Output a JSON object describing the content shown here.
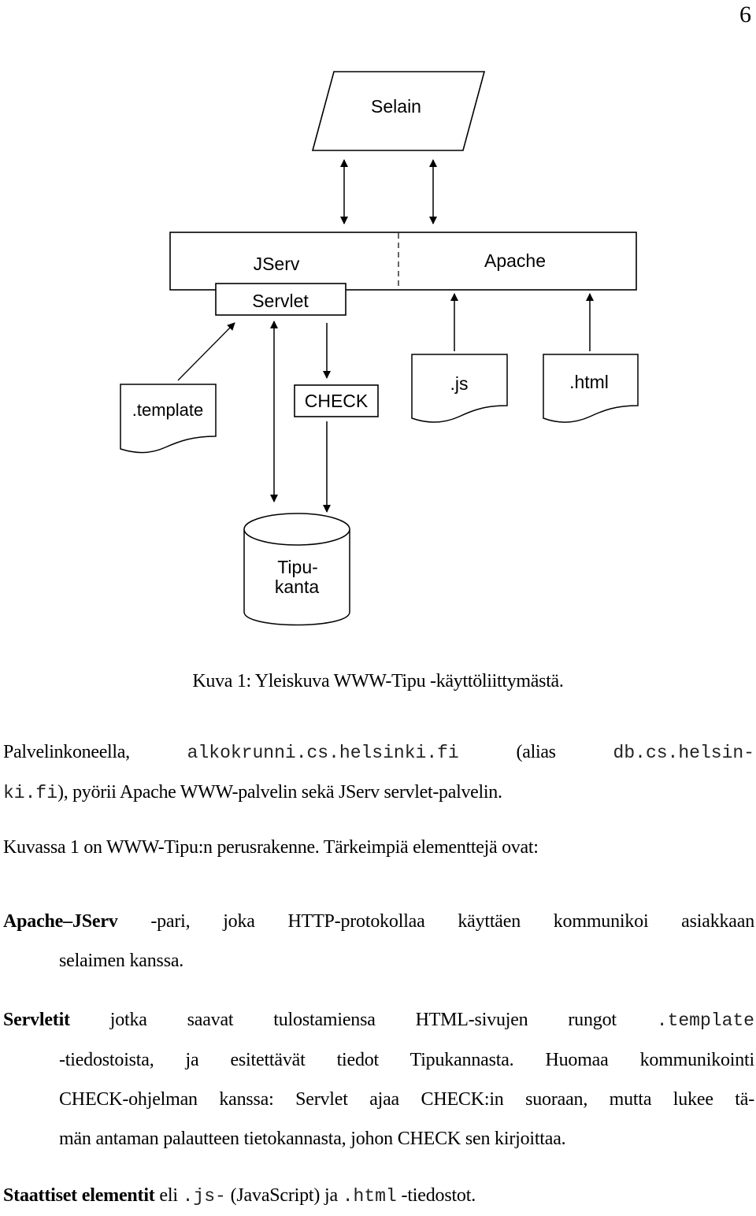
{
  "page_number": "6",
  "diagram": {
    "nodes": {
      "browser": "Selain",
      "jserv": "JServ",
      "apache": "Apache",
      "servlet": "Servlet",
      "template": ".template",
      "check": "CHECK",
      "js": ".js",
      "html": ".html",
      "db_line1": "Tipu-",
      "db_line2": "kanta"
    }
  },
  "caption": "Kuva 1: Yleiskuva WWW-Tipu -käyttöliittymästä.",
  "para1": {
    "t1": "Palvelinkoneella, ",
    "host": "alkokrunni.cs.helsinki.fi",
    "t2": " (alias ",
    "alias1": "db.cs.helsin-",
    "alias2": "ki.fi",
    "t3": "), pyörii Apache WWW-palvelin sekä JServ servlet-palvelin."
  },
  "para2": "Kuvassa 1 on WWW-Tipu:n perusrakenne. Tärkeimpiä elementtejä ovat:",
  "items": [
    {
      "term": "Apache–JServ",
      "line1": " -pari, joka HTTP-protokollaa käyttäen kommunikoi asiakkaan",
      "line2": "selaimen kanssa."
    },
    {
      "term": "Servletit",
      "line1": " jotka saavat tulostamiensa HTML-sivujen rungot ",
      "code": ".template",
      "line2": "-tiedostoista, ja esitettävät tiedot Tipukannasta. Huomaa kommunikointi",
      "line3": "CHECK-ohjelman kanssa: Servlet ajaa CHECK:in suoraan, mutta lukee tä-",
      "line4": "män antaman palautteen tietokannasta, johon CHECK sen kirjoittaa."
    },
    {
      "term": "Staattiset elementit",
      "t1": " eli ",
      "code1": ".js-",
      "t2": " (JavaScript) ja ",
      "code2": ".html",
      "t3": " -tiedostot."
    }
  ]
}
